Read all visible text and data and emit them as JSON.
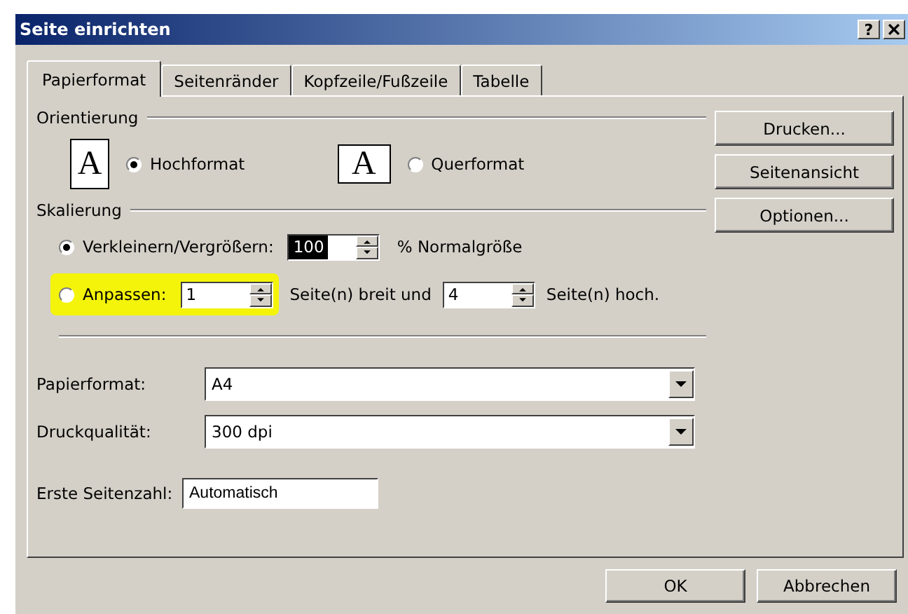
{
  "window": {
    "title": "Seite einrichten",
    "help_label": "?"
  },
  "tabs": [
    {
      "label": "Papierformat",
      "selected": true
    },
    {
      "label": "Seitenränder",
      "selected": false
    },
    {
      "label": "Kopfzeile/Fußzeile",
      "selected": false
    },
    {
      "label": "Tabelle",
      "selected": false
    }
  ],
  "orientation": {
    "title": "Orientierung",
    "options": [
      {
        "kind": "portrait",
        "glyph": "A",
        "label": "Hochformat",
        "selected": true
      },
      {
        "kind": "landscape",
        "glyph": "A",
        "label": "Querformat",
        "selected": false
      }
    ]
  },
  "scaling": {
    "title": "Skalierung",
    "options": [
      {
        "label": "Verkleinern/Vergrößern:",
        "selected": true,
        "value": "100",
        "value_selected": true,
        "highlighted": false,
        "suffix": "% Normalgröße"
      },
      {
        "label": "Anpassen:",
        "selected": false,
        "value": "1",
        "value_selected": false,
        "highlighted": true,
        "middle": "Seite(n) breit und",
        "value2": "4",
        "suffix": "Seite(n) hoch."
      }
    ]
  },
  "fields": [
    {
      "kind": "dropdown",
      "label": "Papierformat:",
      "value": "A4"
    },
    {
      "kind": "dropdown",
      "label": "Druckqualität:",
      "value": "300 dpi"
    },
    {
      "kind": "text",
      "label": "Erste Seitenzahl:",
      "value": "Automatisch"
    }
  ],
  "side_buttons": [
    "Drucken...",
    "Seitenansicht",
    "Optionen..."
  ],
  "footer_buttons": [
    "OK",
    "Abbrechen"
  ]
}
